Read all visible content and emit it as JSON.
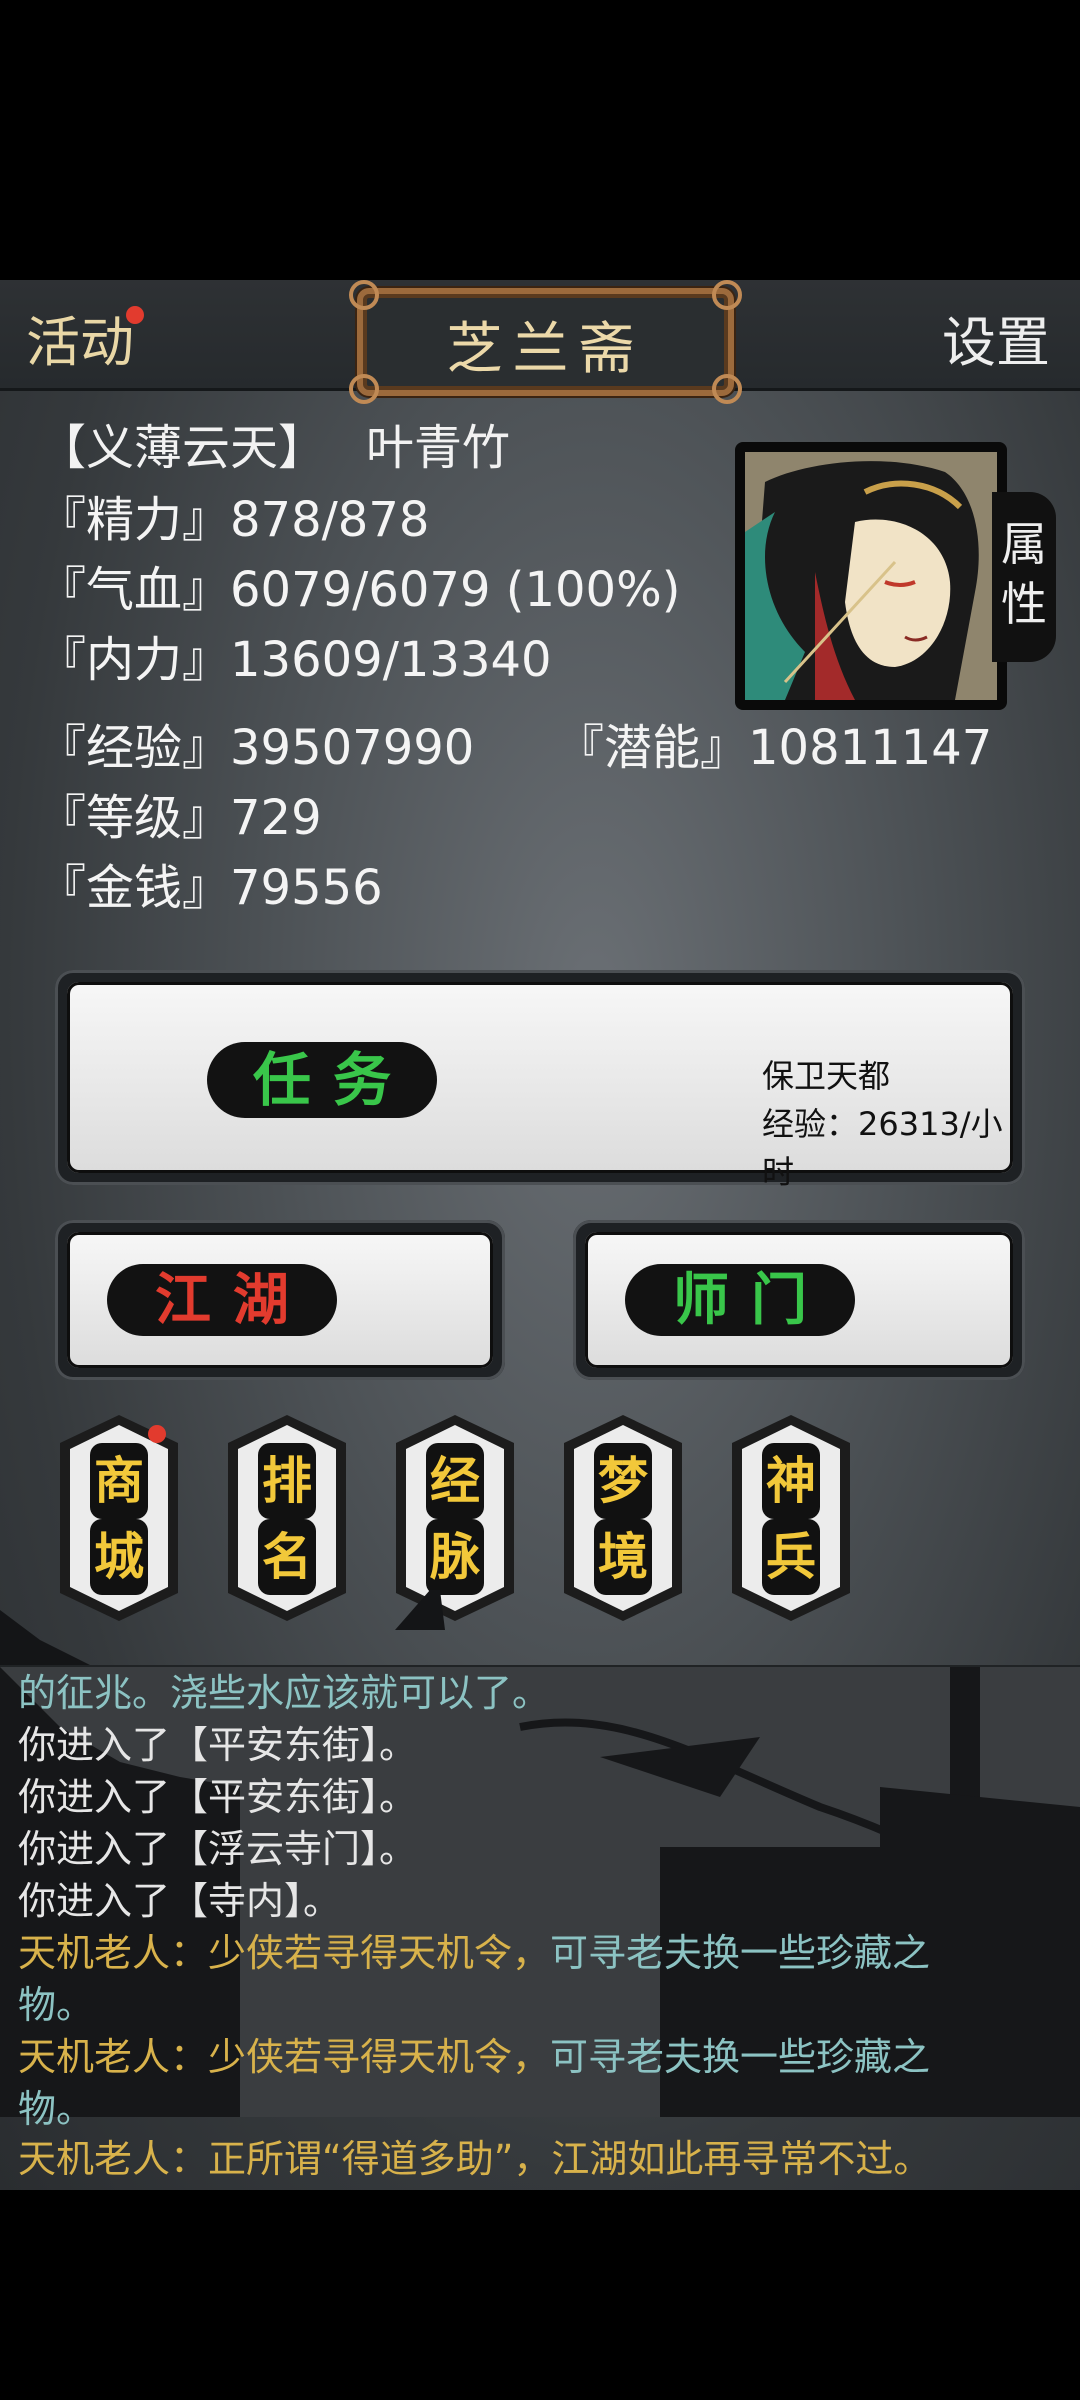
{
  "header": {
    "left_label": "活动",
    "title": "芝兰斋",
    "right_label": "设置"
  },
  "player": {
    "title": "【义薄云天】",
    "name": "叶青竹",
    "attr_tab": "属性"
  },
  "stats": {
    "energy": "『精力』878/878",
    "hp": "『气血』6079/6079 (100%)",
    "inner": "『内力』13609/13340",
    "exp": "『经验』39507990",
    "potential": "『潜能』10811147",
    "level": "『等级』729",
    "money": "『金钱』79556"
  },
  "quest": {
    "button": "任务",
    "name": "保卫天都",
    "rate": "经验：26313/小时"
  },
  "buttons": {
    "jianghu": "江湖",
    "shimen": "师门"
  },
  "shortcuts": [
    {
      "top": "商",
      "bottom": "城"
    },
    {
      "top": "排",
      "bottom": "名"
    },
    {
      "top": "经",
      "bottom": "脉"
    },
    {
      "top": "梦",
      "bottom": "境"
    },
    {
      "top": "神",
      "bottom": "兵"
    }
  ],
  "log": [
    {
      "text": "的征兆。浇些水应该就可以了。",
      "color": "teal"
    },
    {
      "text": "你进入了【平安东街】。",
      "color": "white"
    },
    {
      "text": "你进入了【平安东街】。",
      "color": "white"
    },
    {
      "text": "你进入了【浮云寺门】。",
      "color": "white"
    },
    {
      "text": "你进入了【寺内】。",
      "color": "white"
    },
    {
      "speaker": "天机老人：",
      "a": "少侠若寻得天机令，",
      "b": "可寻老夫换一些珍藏之"
    },
    {
      "text": "物。",
      "color": "teal"
    },
    {
      "speaker": "天机老人：",
      "a": "少侠若寻得天机令，",
      "b": "可寻老夫换一些珍藏之"
    },
    {
      "text": "物。",
      "color": "teal"
    },
    {
      "speaker": "天机老人：",
      "a": "正所谓“得道多助”，江湖如此再寻常不过。",
      "b": ""
    }
  ],
  "colors": {
    "gold_text": "#f2c83a",
    "green_text": "#39c64a",
    "red_text": "#e23b2e",
    "teal_text": "#8cc3c3",
    "log_gold": "#d8b24b"
  }
}
